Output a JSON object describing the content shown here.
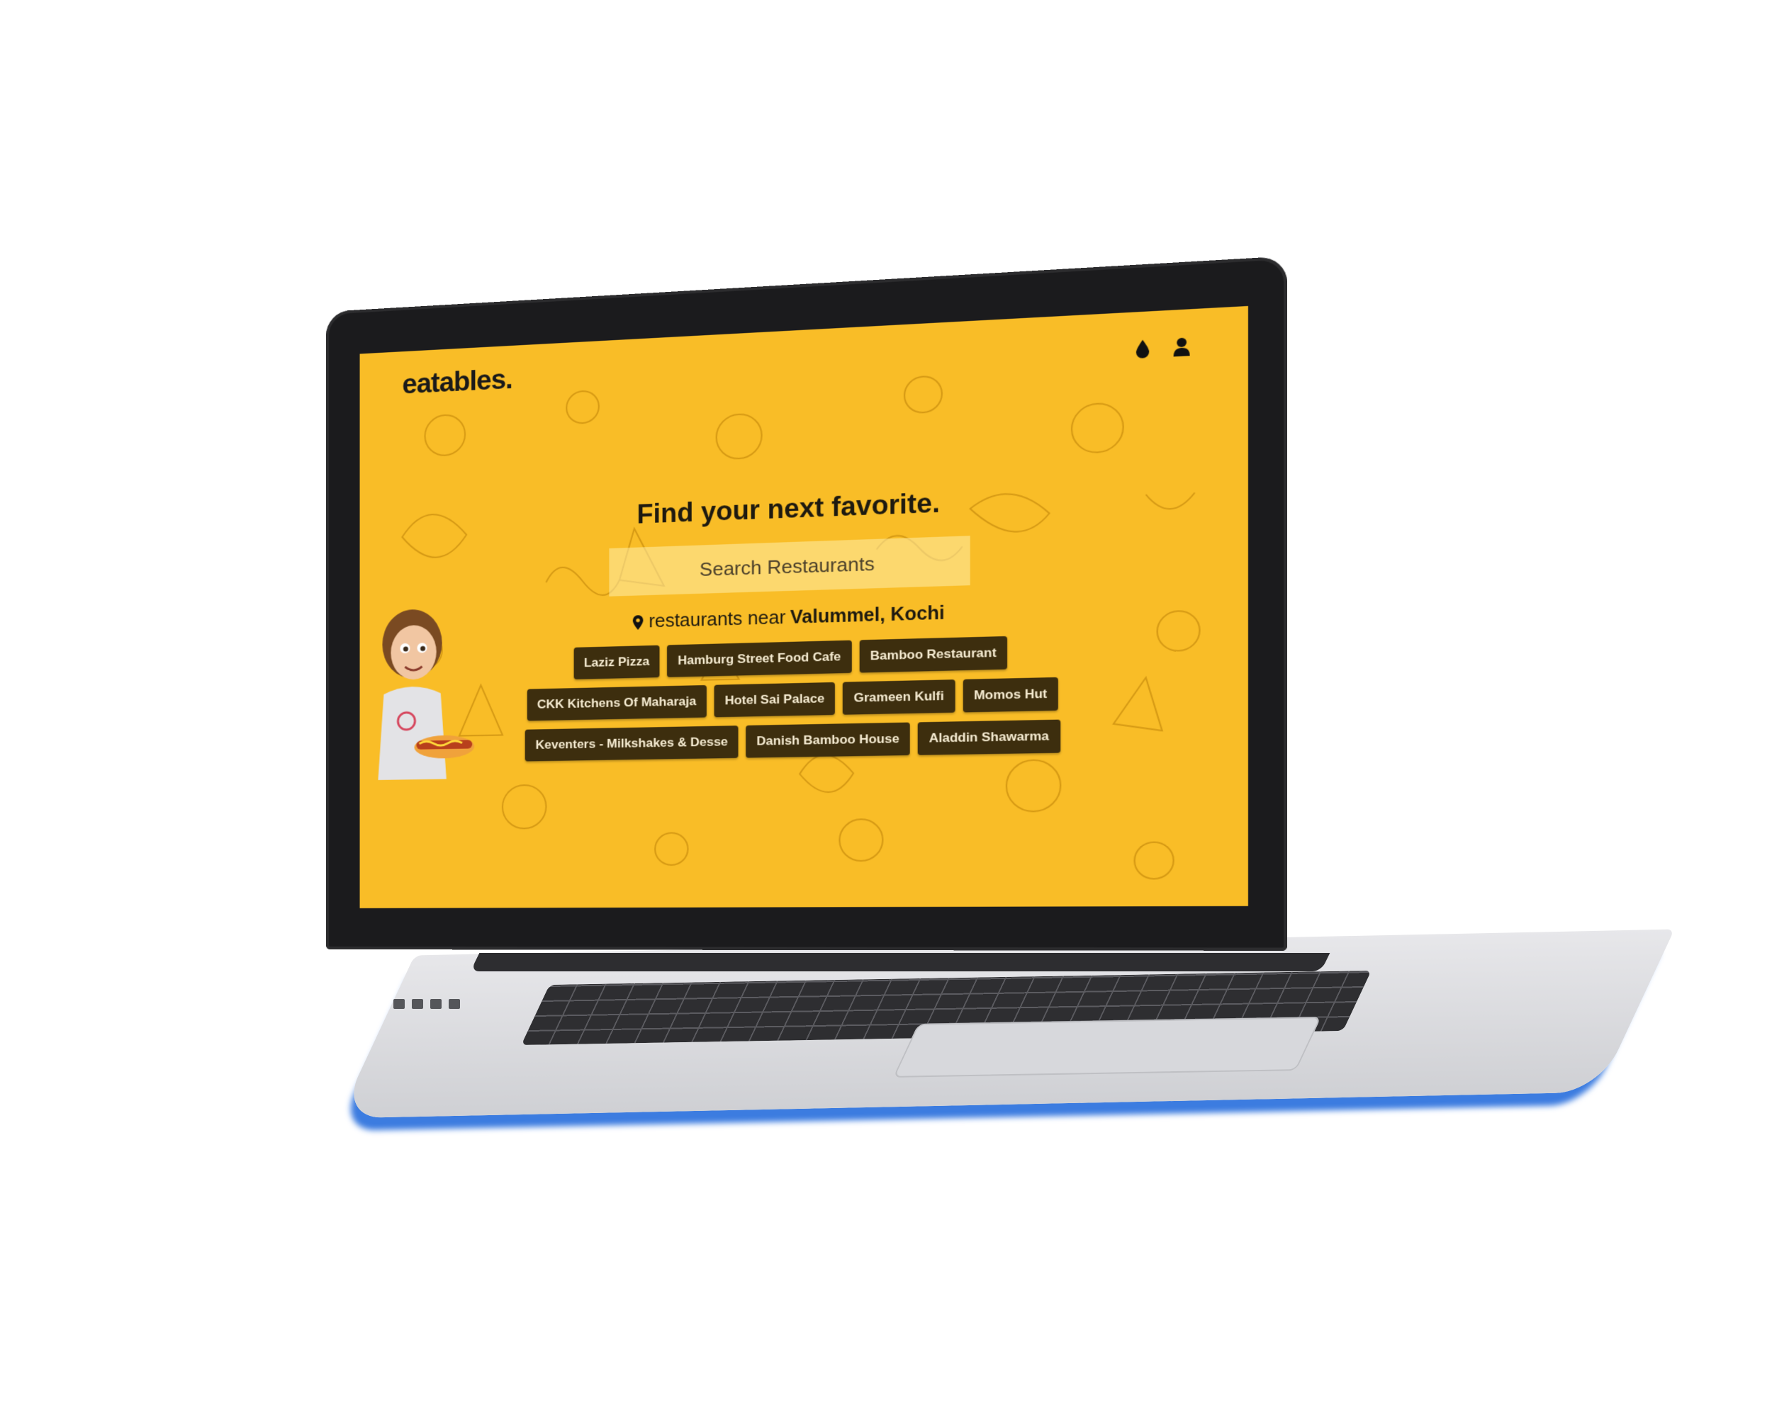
{
  "header": {
    "brand": "eatables."
  },
  "icons": {
    "theme": "drop-icon",
    "account": "user-icon"
  },
  "hero": {
    "title": "Find your next favorite.",
    "search_placeholder": "Search Restaurants",
    "near_prefix": "restaurants near",
    "near_location": "Valummel, Kochi"
  },
  "restaurants": [
    "Laziz Pizza",
    "Hamburg Street Food Cafe",
    "Bamboo Restaurant",
    "CKK Kitchens Of Maharaja",
    "Hotel Sai Palace",
    "Grameen Kulfi",
    "Momos Hut",
    "Keventers - Milkshakes & Desse",
    "Danish Bamboo House",
    "Aladdin Shawarma"
  ],
  "colors": {
    "background": "#f9bd27",
    "chip": "#3d2e0e",
    "chip_text": "#f6ecd2",
    "text": "#1e1a10"
  }
}
